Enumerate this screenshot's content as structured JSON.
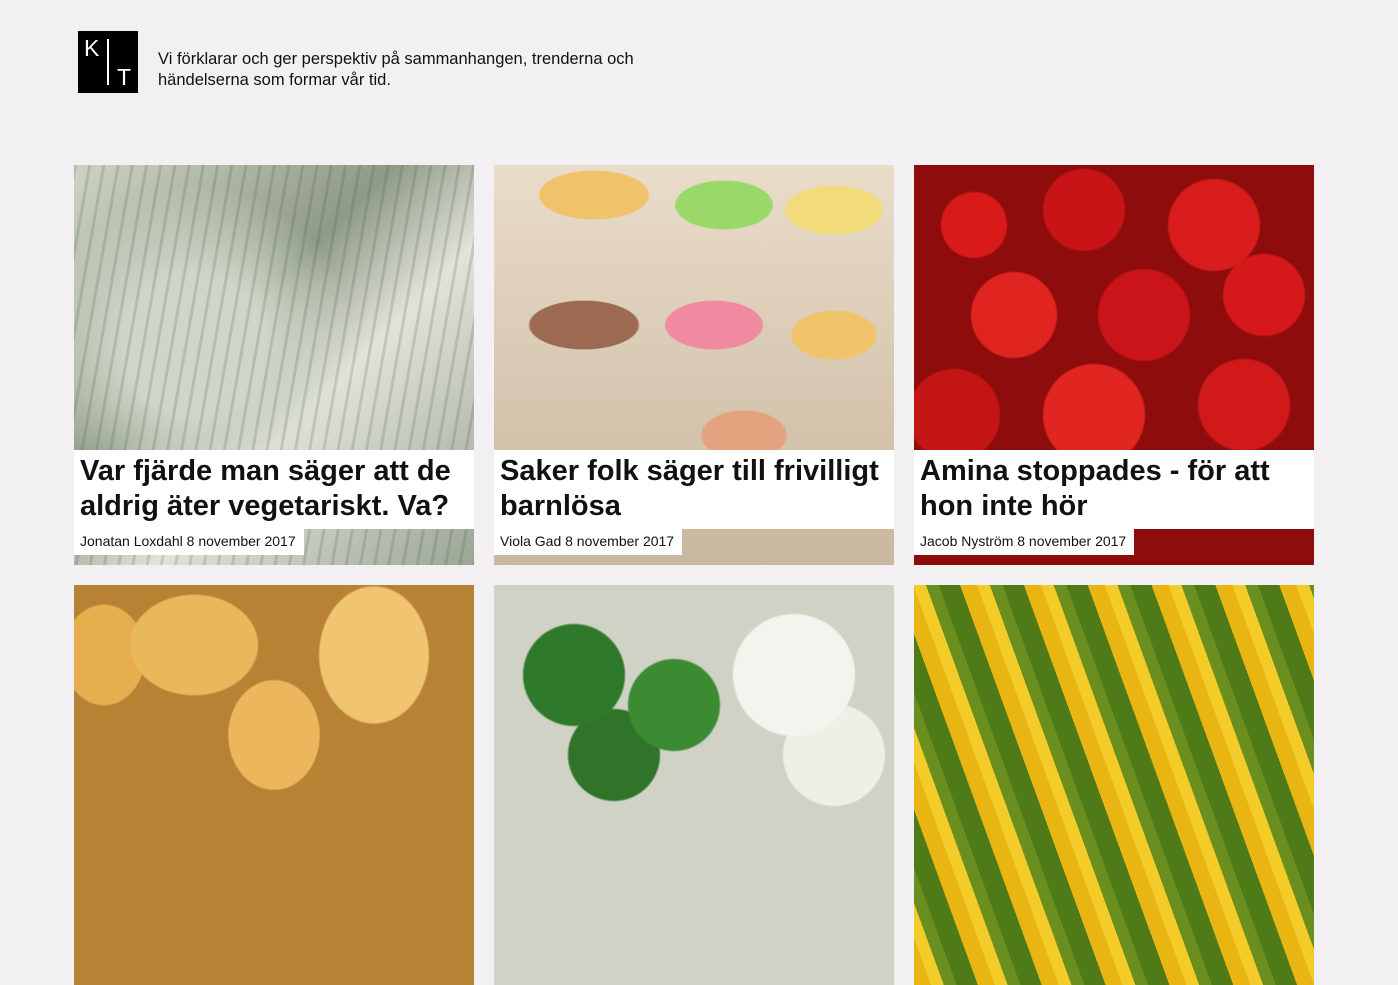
{
  "header": {
    "logo_letters": [
      "K",
      "T"
    ],
    "tagline": "Vi förklarar och ger perspektiv på sammanhangen, trenderna och händelserna som formar vår tid."
  },
  "cards": [
    {
      "image": "dollar-bills-image",
      "title": "Var fjärde man säger att de aldrig äter vegetariskt. Va?",
      "byline": "Jonatan Loxdahl 8 november 2017"
    },
    {
      "image": "macarons-image",
      "title": "Saker folk säger till frivilligt barnlösa",
      "byline": "Viola Gad 8 november 2017"
    },
    {
      "image": "red-apples-image",
      "title": "Amina stoppades - för att hon inte hör",
      "byline": "Jacob Nyström 8 november 2017"
    },
    {
      "image": "potatoes-image"
    },
    {
      "image": "broccoli-cauliflower-image"
    },
    {
      "image": "corn-image"
    }
  ]
}
